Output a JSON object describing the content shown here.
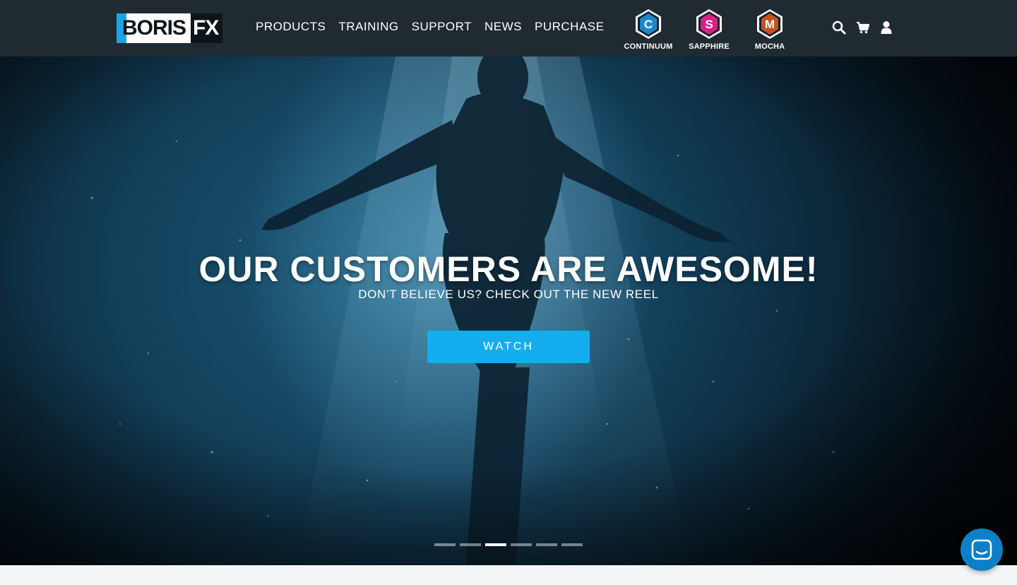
{
  "header": {
    "logo": {
      "word": "BORIS",
      "suffix": "FX"
    },
    "nav": [
      "PRODUCTS",
      "TRAINING",
      "SUPPORT",
      "NEWS",
      "PURCHASE"
    ],
    "products": [
      {
        "letter": "C",
        "label": "CONTINUUM",
        "color": "#1b87c9"
      },
      {
        "letter": "S",
        "label": "SAPPHIRE",
        "color": "#d81f85"
      },
      {
        "letter": "M",
        "label": "MOCHA",
        "color": "#c8501e"
      }
    ],
    "tools": [
      "search-icon",
      "cart-icon",
      "user-icon"
    ]
  },
  "hero": {
    "title": "OUR CUSTOMERS ARE AWESOME!",
    "subtitle": "DON’T BELIEVE US? CHECK OUT THE NEW REEL",
    "button": "WATCH",
    "slides": 6,
    "active_slide": 3
  },
  "chat": {
    "icon": "chat-icon"
  },
  "colors": {
    "header_bg": "#1f2a31",
    "accent": "#14aef0",
    "chat": "#0d7fc6"
  }
}
